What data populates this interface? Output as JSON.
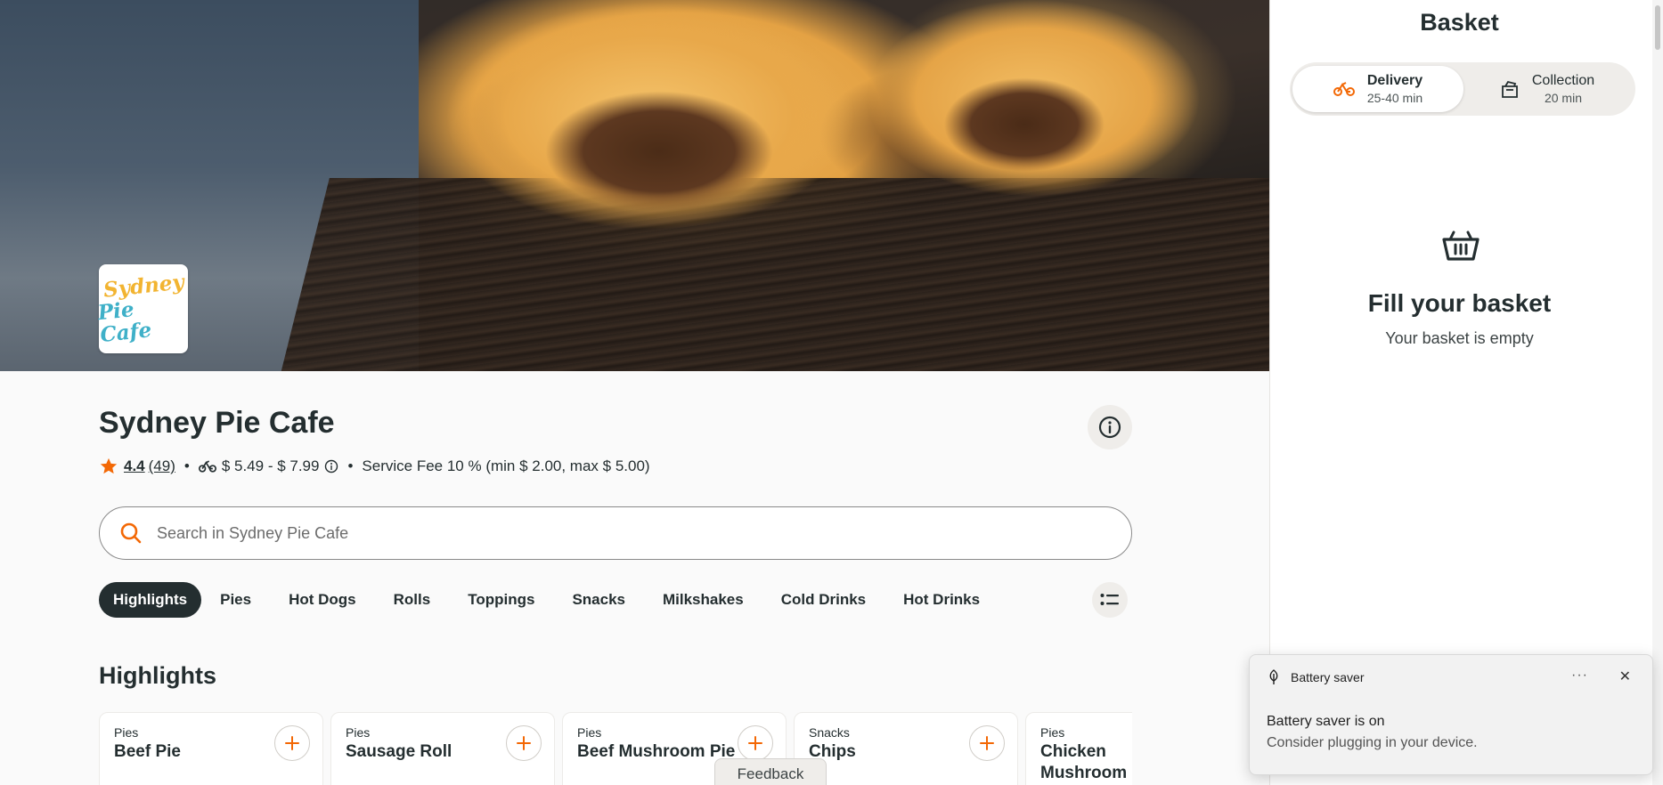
{
  "restaurant": {
    "logo_line1": "Sydney",
    "logo_line2": "Pie Cafe",
    "name": "Sydney Pie Cafe",
    "rating": "4.4",
    "rating_count": "(49)",
    "delivery_fee": "$ 5.49 - $ 7.99",
    "service_fee": "Service Fee 10 % (min $ 2.00, max $ 5.00)"
  },
  "search": {
    "placeholder": "Search in Sydney Pie Cafe"
  },
  "categories": [
    {
      "label": "Highlights",
      "active": true
    },
    {
      "label": "Pies"
    },
    {
      "label": "Hot Dogs"
    },
    {
      "label": "Rolls"
    },
    {
      "label": "Toppings"
    },
    {
      "label": "Snacks"
    },
    {
      "label": "Milkshakes"
    },
    {
      "label": "Cold Drinks"
    },
    {
      "label": "Hot Drinks"
    }
  ],
  "section": {
    "title": "Highlights"
  },
  "items": [
    {
      "category": "Pies",
      "name": "Beef Pie"
    },
    {
      "category": "Pies",
      "name": "Sausage Roll"
    },
    {
      "category": "Pies",
      "name": "Beef Mushroom Pie"
    },
    {
      "category": "Snacks",
      "name": "Chips"
    },
    {
      "category": "Pies",
      "name": "Chicken Mushroom Pie"
    }
  ],
  "feedback": {
    "label": "Feedback"
  },
  "basket": {
    "title": "Basket",
    "delivery_label": "Delivery",
    "delivery_time": "25-40 min",
    "collection_label": "Collection",
    "collection_time": "20 min",
    "empty_title": "Fill your basket",
    "empty_subtitle": "Your basket is empty"
  },
  "toast": {
    "title": "Battery saver",
    "more": "···",
    "close": "✕",
    "line1": "Battery saver is on",
    "line2": "Consider plugging in your device."
  },
  "colors": {
    "accent": "#f36805",
    "dark": "#242e30",
    "star": "#f36805"
  }
}
